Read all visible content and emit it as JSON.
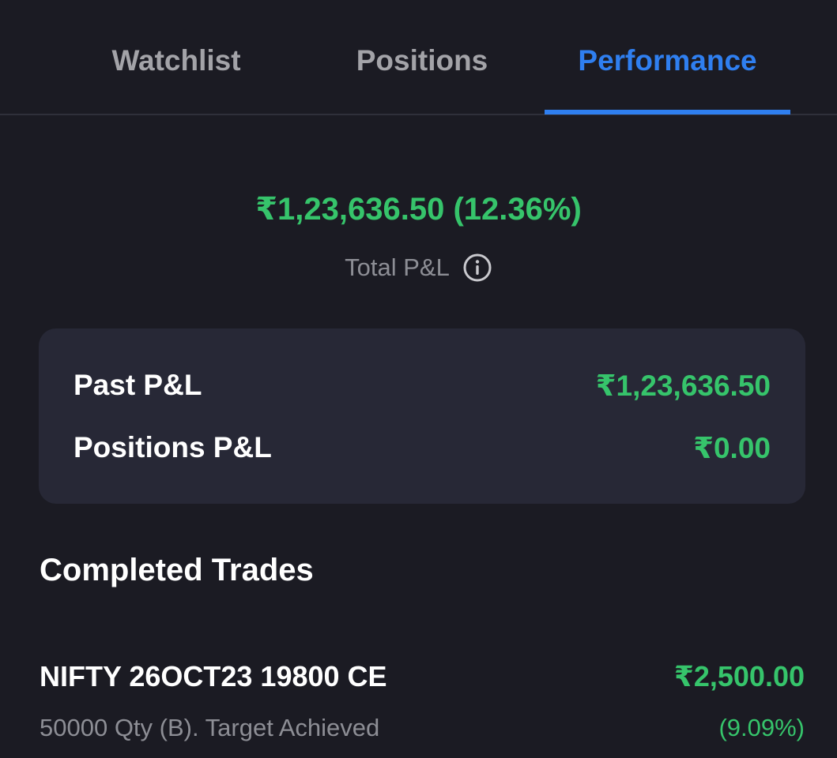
{
  "tabs": [
    {
      "label": "Watchlist",
      "active": false
    },
    {
      "label": "Positions",
      "active": false
    },
    {
      "label": "Performance",
      "active": true
    }
  ],
  "colors": {
    "background": "#1b1b23",
    "card": "#272836",
    "accent": "#2f7ff0",
    "profit": "#36c46b",
    "muted": "#8d8e95"
  },
  "summary": {
    "total_value": "₹1,23,636.50 (12.36%)",
    "total_label": "Total P&L",
    "info_icon": "info-icon"
  },
  "pnl_card": {
    "rows": [
      {
        "label": "Past P&L",
        "value": "₹1,23,636.50"
      },
      {
        "label": "Positions P&L",
        "value": "₹0.00"
      }
    ]
  },
  "completed_trades": {
    "title": "Completed Trades",
    "items": [
      {
        "symbol": "NIFTY 26OCT23 19800 CE",
        "pnl": "₹2,500.00",
        "detail": "50000 Qty (B). Target Achieved",
        "pnl_percent": "(9.09%)"
      }
    ]
  }
}
